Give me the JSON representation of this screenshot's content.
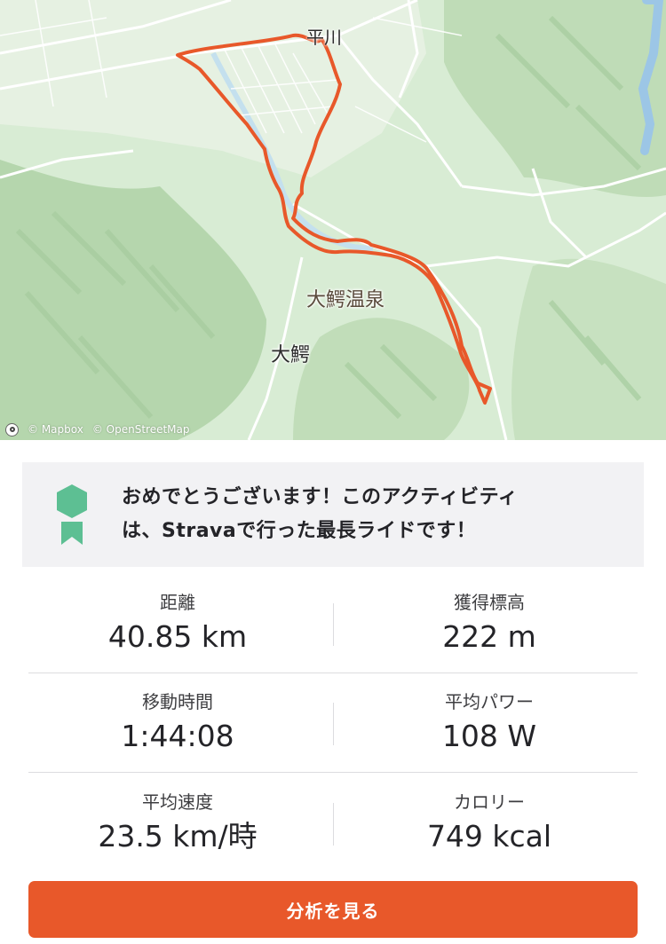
{
  "map": {
    "attribution_mapbox": "© Mapbox",
    "attribution_osm": "© OpenStreetMap",
    "places": [
      {
        "key": "hirakawa",
        "label": "平川"
      },
      {
        "key": "owani_onsen",
        "label": "大鰐温泉"
      },
      {
        "key": "owani",
        "label": "大鰐"
      }
    ],
    "route_color": "#e8582a"
  },
  "banner": {
    "line1": "おめでとうございます！このアクティビティ",
    "line2": "は、Stravaで行った最長ライドです！",
    "badge_color": "#5dbf93"
  },
  "stats": [
    {
      "label": "距離",
      "value": "40.85 km"
    },
    {
      "label": "獲得標高",
      "value": "222 m"
    },
    {
      "label": "移動時間",
      "value": "1:44:08"
    },
    {
      "label": "平均パワー",
      "value": "108 W"
    },
    {
      "label": "平均速度",
      "value": "23.5 km/時"
    },
    {
      "label": "カロリー",
      "value": "749 kcal"
    }
  ],
  "cta": {
    "label": "分析を見る",
    "color": "#e8582a"
  }
}
